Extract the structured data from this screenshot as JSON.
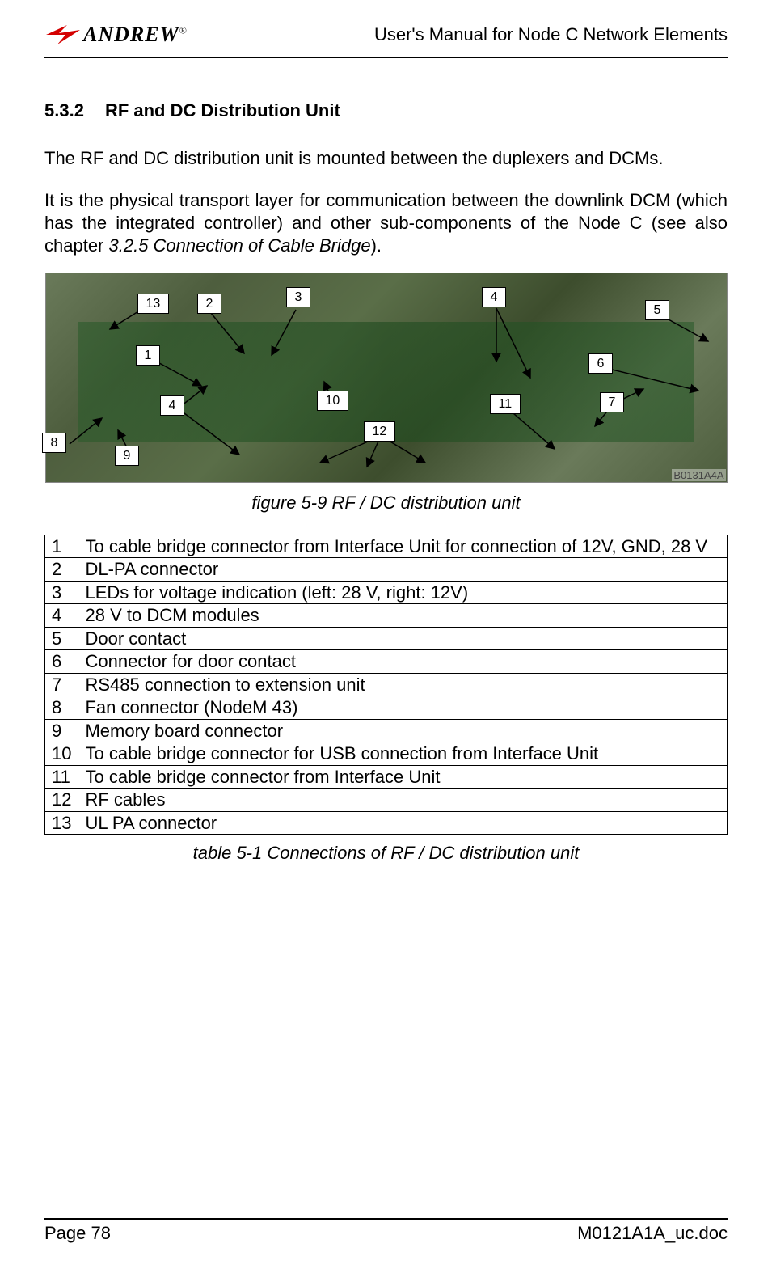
{
  "header": {
    "logo_text": "ANDREW",
    "reg": "®",
    "doc_title": "User's Manual for Node C Network Elements"
  },
  "section": {
    "number": "5.3.2",
    "title": "RF and DC Distribution Unit"
  },
  "paragraphs": {
    "p1": "The RF and DC distribution unit is mounted between the duplexers and DCMs.",
    "p2a": "It is the physical transport layer for communication between the downlink DCM (which has the integrated controller) and other sub-components of the Node C (see also chapter ",
    "p2b": "3.2.5 Connection of Cable Bridge",
    "p2c": ")."
  },
  "figure": {
    "caption": "figure 5-9 RF / DC distribution unit",
    "image_id": "B0131A4A",
    "callouts": {
      "c1": "1",
      "c2": "2",
      "c3": "3",
      "c4a": "4",
      "c4b": "4",
      "c5": "5",
      "c6": "6",
      "c7": "7",
      "c8": "8",
      "c9": "9",
      "c10": "10",
      "c11": "11",
      "c12": "12",
      "c13": "13"
    }
  },
  "legend": [
    {
      "n": "1",
      "d": "To cable bridge connector from Interface Unit for connection of 12V, GND, 28 V"
    },
    {
      "n": "2",
      "d": "DL-PA connector"
    },
    {
      "n": "3",
      "d": "LEDs for voltage indication (left: 28 V, right: 12V)"
    },
    {
      "n": "4",
      "d": "28 V to DCM modules"
    },
    {
      "n": "5",
      "d": "Door contact"
    },
    {
      "n": "6",
      "d": "Connector for door contact"
    },
    {
      "n": "7",
      "d": "RS485 connection to extension unit"
    },
    {
      "n": "8",
      "d": "Fan connector (NodeM 43)"
    },
    {
      "n": "9",
      "d": "Memory board connector"
    },
    {
      "n": "10",
      "d": "To cable bridge connector for USB connection from Interface Unit"
    },
    {
      "n": "11",
      "d": "To cable bridge connector from Interface Unit"
    },
    {
      "n": "12",
      "d": "RF cables"
    },
    {
      "n": "13",
      "d": "UL PA connector"
    }
  ],
  "table_caption": "table 5-1 Connections of RF / DC distribution unit",
  "footer": {
    "page": "Page 78",
    "doc": "M0121A1A_uc.doc"
  }
}
